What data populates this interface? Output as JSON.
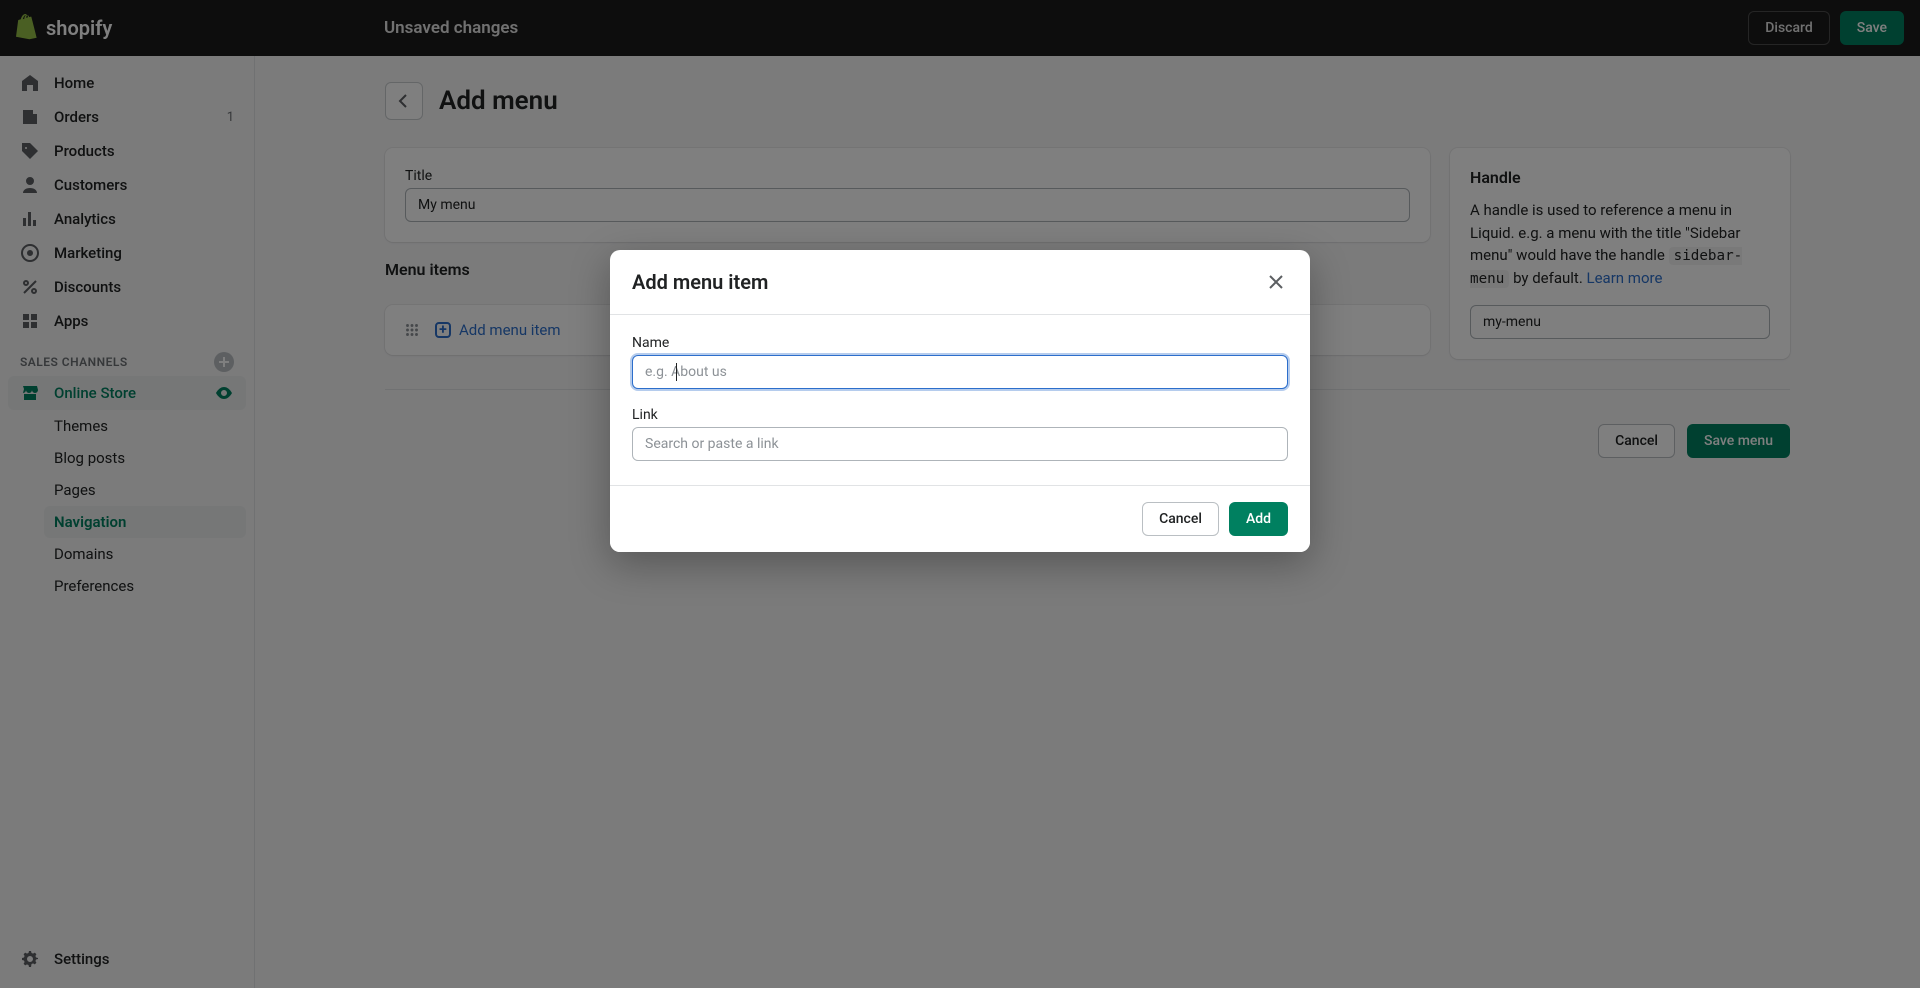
{
  "logo_text": "shopify",
  "topbar": {
    "unsaved": "Unsaved changes",
    "discard": "Discard",
    "save": "Save"
  },
  "sidebar": {
    "items": [
      {
        "label": "Home"
      },
      {
        "label": "Orders",
        "badge": "1"
      },
      {
        "label": "Products"
      },
      {
        "label": "Customers"
      },
      {
        "label": "Analytics"
      },
      {
        "label": "Marketing"
      },
      {
        "label": "Discounts"
      },
      {
        "label": "Apps"
      }
    ],
    "section_header": "SALES CHANNELS",
    "online_store": "Online Store",
    "subnav": [
      {
        "label": "Themes"
      },
      {
        "label": "Blog posts"
      },
      {
        "label": "Pages"
      },
      {
        "label": "Navigation"
      },
      {
        "label": "Domains"
      },
      {
        "label": "Preferences"
      }
    ],
    "settings": "Settings"
  },
  "page": {
    "title": "Add menu",
    "title_card": {
      "label": "Title",
      "value": "My menu"
    },
    "menu_items_label": "Menu items",
    "add_menu_item_link": "Add menu item",
    "handle_card": {
      "title": "Handle",
      "desc_prefix": "A handle is used to reference a menu in Liquid. e.g. a menu with the title \"Sidebar menu\" would have the handle ",
      "code": "sidebar-menu",
      "desc_suffix": " by default. ",
      "learn_more": "Learn more",
      "value": "my-menu"
    },
    "footer": {
      "cancel": "Cancel",
      "save": "Save menu"
    }
  },
  "modal": {
    "title": "Add menu item",
    "name_label": "Name",
    "name_placeholder": "e.g. About us",
    "link_label": "Link",
    "link_placeholder": "Search or paste a link",
    "cancel": "Cancel",
    "add": "Add"
  }
}
